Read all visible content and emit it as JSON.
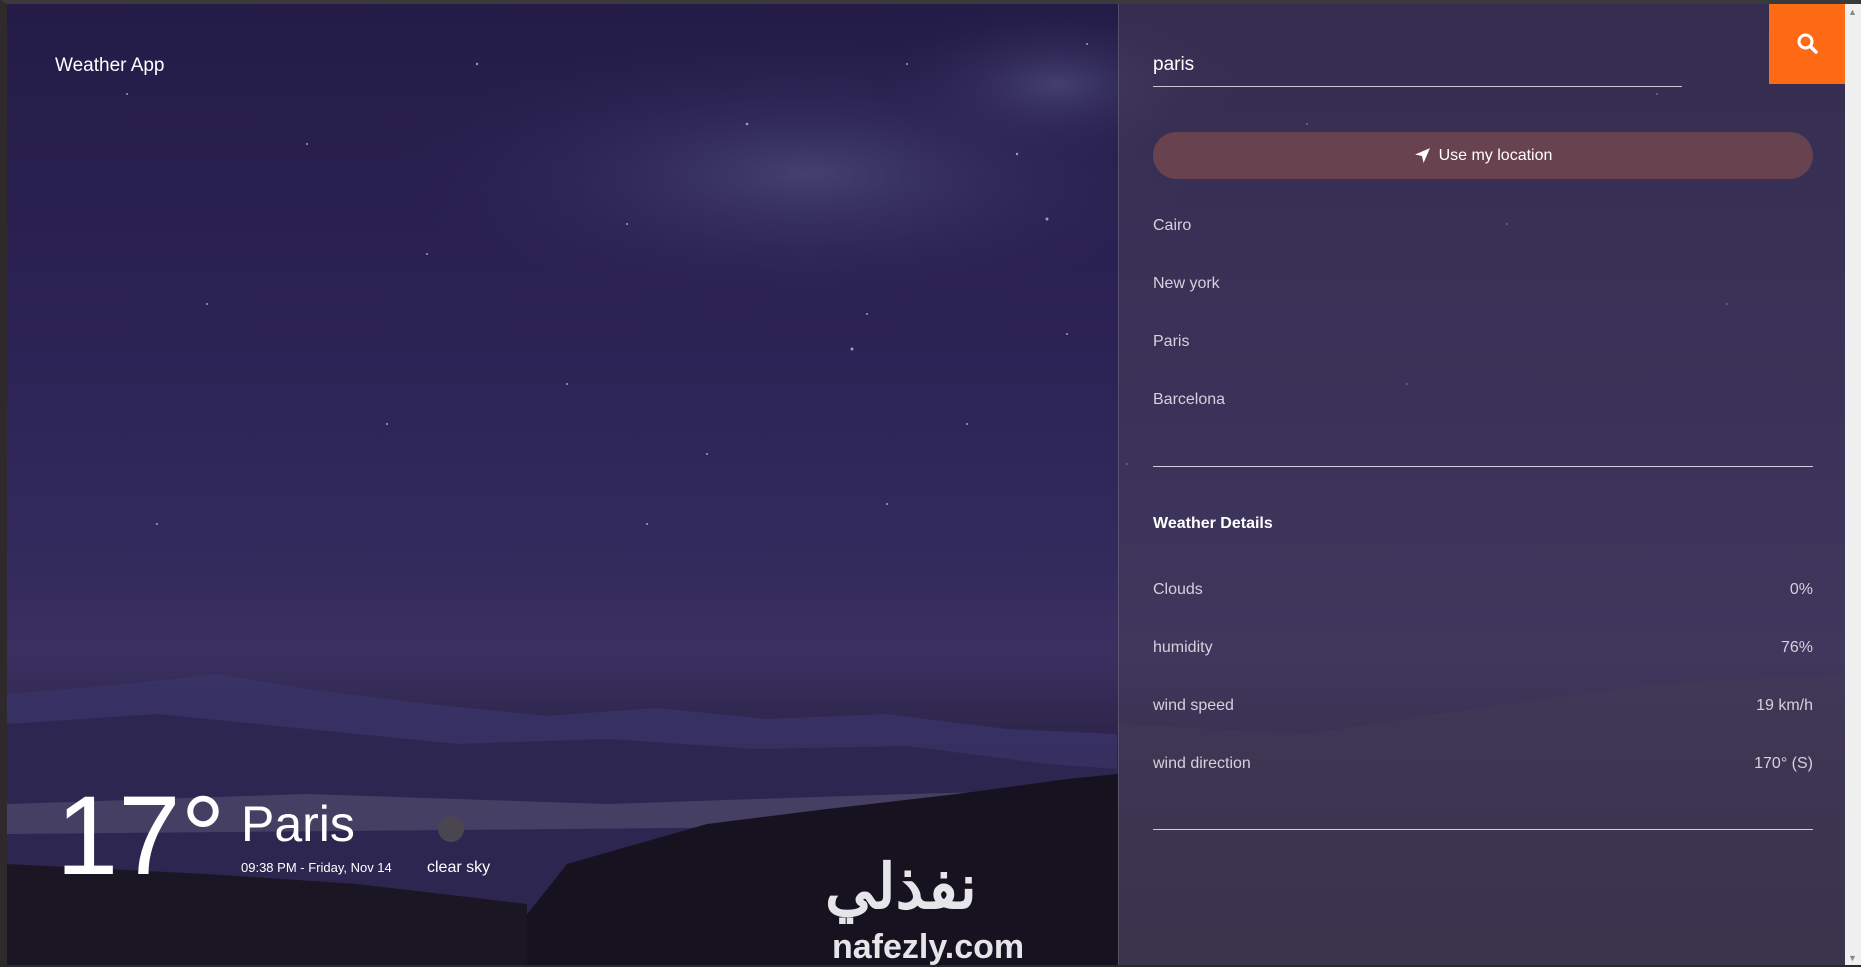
{
  "app": {
    "title": "Weather App"
  },
  "current": {
    "temperature": "17°",
    "city": "Paris",
    "datetime": "09:38 PM - Friday, Nov 14",
    "condition": "clear sky"
  },
  "watermark": {
    "arabic": "نفذلي",
    "latin": "nafezly.com"
  },
  "search": {
    "value": "paris",
    "placeholder": "",
    "button_icon": "search-icon"
  },
  "location_button": {
    "label": "Use my location",
    "icon": "location-arrow-icon"
  },
  "cities": [
    "Cairo",
    "New york",
    "Paris",
    "Barcelona"
  ],
  "details": {
    "title": "Weather Details",
    "rows": [
      {
        "label": "Clouds",
        "value": "0%"
      },
      {
        "label": "humidity",
        "value": "76%"
      },
      {
        "label": "wind speed",
        "value": "19 km/h"
      },
      {
        "label": "wind direction",
        "value": "170° (S)"
      }
    ]
  },
  "colors": {
    "accent": "#ff6a14",
    "location_button": "#784850"
  }
}
